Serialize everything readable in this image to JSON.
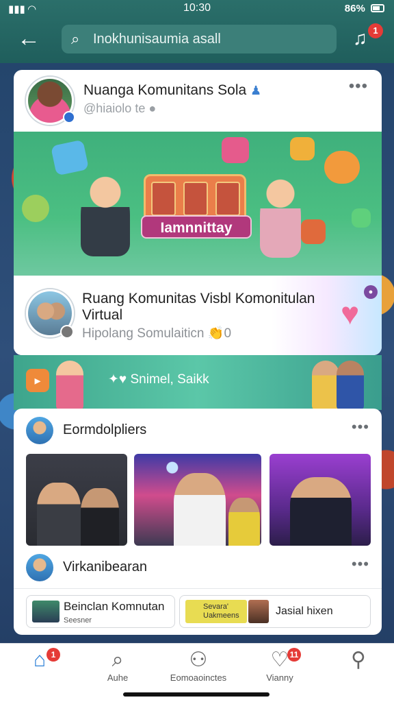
{
  "status": {
    "left": "Ι",
    "time": "10:30",
    "battery": "86%"
  },
  "header": {
    "search_text": "Inokhunisaumia asall",
    "notification_count": "1"
  },
  "post": {
    "profile_name": "Nuanga Komunitans Sola",
    "profile_handle": "@hiaiolo te",
    "banner_label": "Iamnnittay",
    "group_title": "Ruang Komunitas Visbl Komonitulan Virtual",
    "group_subtitle": "Hipolang Somulaiticn",
    "reactions_text": "Snimel,   Saikk"
  },
  "feed": {
    "section1_title": "Eormdolpliers",
    "section2_title": "Virkanibearan",
    "pill1_title": "Beinclan Komnutan",
    "pill1_sub": "Seesner",
    "pill2_promo": "Sevara' Uakmeens",
    "pill2_title": "Jasial hixen"
  },
  "nav": {
    "items": [
      {
        "label": "",
        "badge": "1"
      },
      {
        "label": "Auhe",
        "badge": ""
      },
      {
        "label": "Eomoaoinctes",
        "badge": ""
      },
      {
        "label": "Vianny",
        "badge": "11"
      },
      {
        "label": "",
        "badge": ""
      }
    ]
  },
  "colors": {
    "header_teal": "#2b6f6a",
    "accent_blue": "#2c7fd6",
    "badge_red": "#e53b37"
  }
}
